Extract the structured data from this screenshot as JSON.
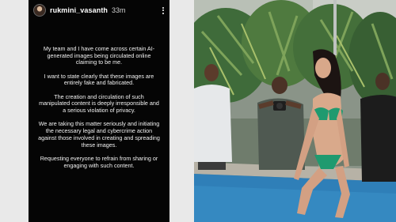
{
  "story": {
    "username": "rukmini_vasanth",
    "time": "33m",
    "paragraphs": [
      "My team and I have come across certain AI-generated images being circulated online claiming to be me.",
      "I want to state clearly that these images are entirely fake and fabricated.",
      "The creation and circulation of such manipulated content is deeply irresponsible and a serious violation of privacy.",
      "We are taking this matter seriously and initiating the necessary legal and cybercrime action against those involved in creating and spreading these images.",
      "Requesting everyone to refrain from sharing or engaging with such content."
    ],
    "icons": {
      "avatar": "profile-avatar",
      "more": "more-options-icon"
    }
  },
  "colors": {
    "background": "#e9e9e9",
    "story_bg": "#050505",
    "swimsuit": "#1f9a6f",
    "pool_water": "#2f7fb8"
  }
}
